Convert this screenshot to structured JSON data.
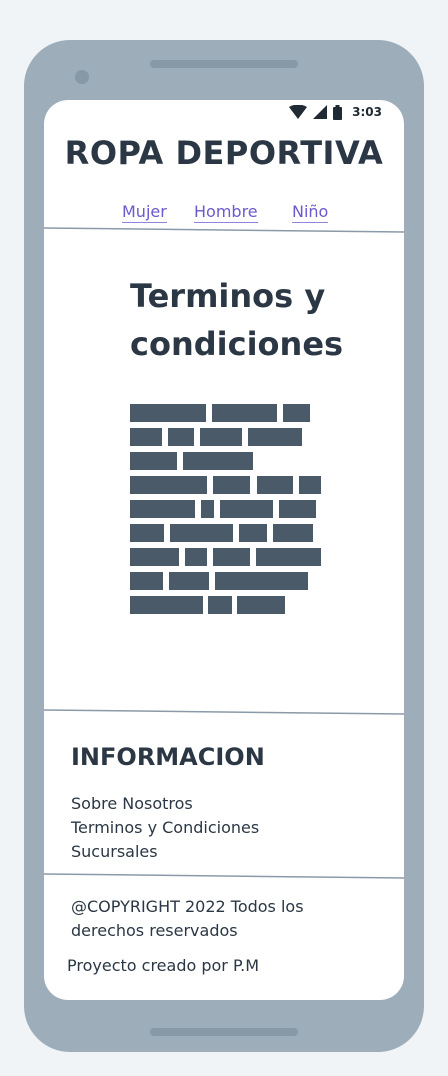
{
  "status": {
    "time": "3:03"
  },
  "header": {
    "title": "ROPA DEPORTIVA"
  },
  "nav": {
    "items": [
      {
        "label": "Mujer"
      },
      {
        "label": "Hombre"
      },
      {
        "label": "Niño"
      }
    ]
  },
  "main": {
    "heading_line1": "Terminos y",
    "heading_line2": "condiciones"
  },
  "footer": {
    "info_title": "INFORMACION",
    "links": [
      "Sobre Nosotros",
      "Terminos y Condiciones",
      "Sucursales"
    ],
    "copyright_line1": "@COPYRIGHT 2022 Todos los",
    "copyright_line2": "derechos reservados",
    "credit": "Proyecto creado por P.M"
  },
  "colors": {
    "accent": "#6a5acd",
    "text": "#2b3744",
    "device": "#9dadba",
    "placeholder": "#4b5a68"
  },
  "icons": [
    "wifi-icon",
    "signal-icon",
    "battery-icon"
  ]
}
